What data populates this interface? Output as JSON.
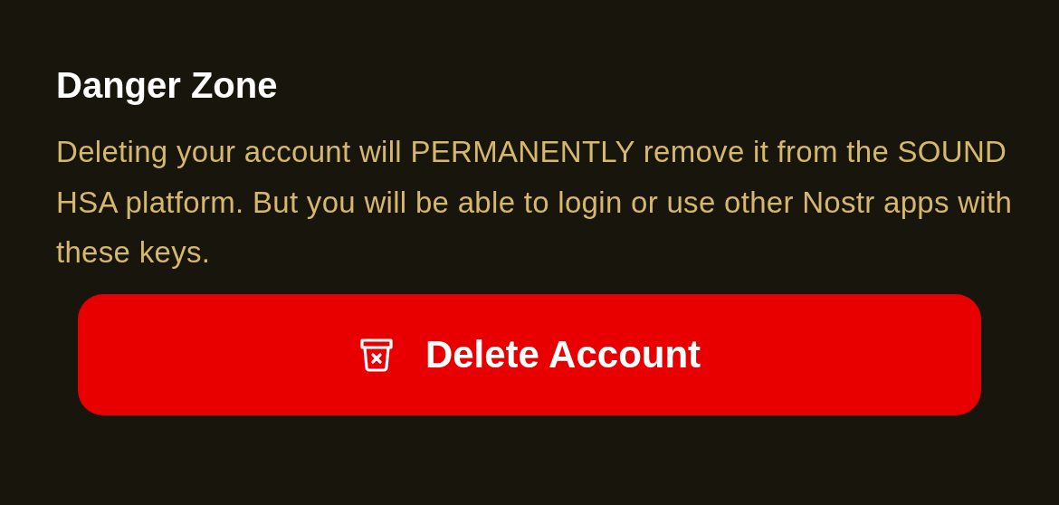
{
  "section": {
    "title": "Danger Zone",
    "description": "Deleting your account will PERMANENTLY remove it from the SOUND HSA platform. But you will be able to login or use other Nostr apps with these keys."
  },
  "button": {
    "label": "Delete Account"
  }
}
